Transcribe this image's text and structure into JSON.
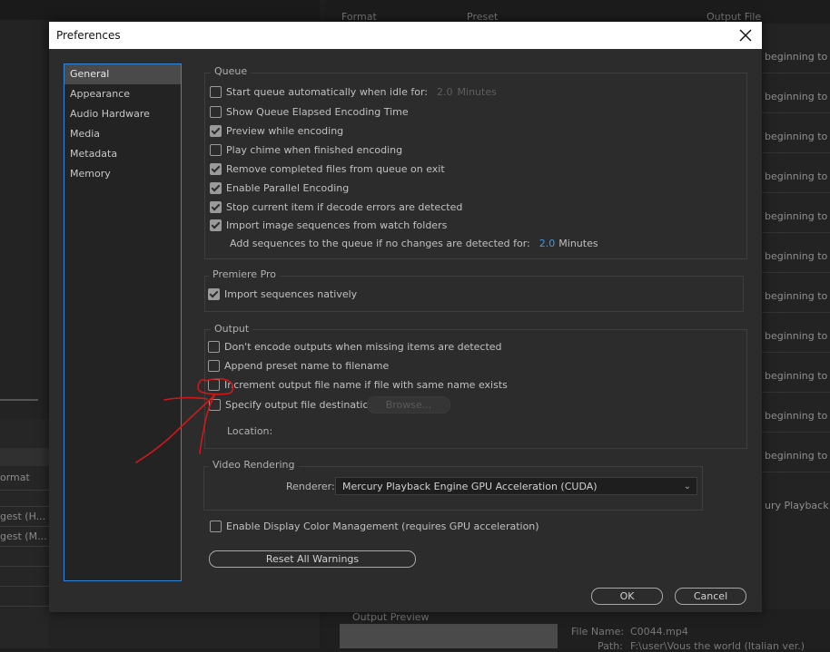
{
  "background": {
    "header": {
      "format": "Format",
      "preset": "Preset",
      "output_file": "Output File"
    },
    "row_text": "beginning to z",
    "row_text_last": "ury Playback E",
    "left_header": "ormat",
    "left_rows": [
      "gest (H...",
      "gest (M..."
    ],
    "bottom": {
      "file_name_label": "File Name:",
      "file_name_value": "C0044.mp4",
      "path_label": "Path:",
      "path_value": "F:\\user\\Vous the world (Italian ver.)",
      "output_preview": "Output Preview"
    }
  },
  "dialog": {
    "title": "Preferences",
    "sidebar": {
      "items": [
        {
          "label": "General",
          "active": true
        },
        {
          "label": "Appearance"
        },
        {
          "label": "Audio Hardware"
        },
        {
          "label": "Media"
        },
        {
          "label": "Metadata"
        },
        {
          "label": "Memory"
        }
      ]
    },
    "queue": {
      "label": "Queue",
      "start_queue": {
        "label": "Start queue automatically when idle for:",
        "value": "2.0",
        "unit": "Minutes",
        "checked": false
      },
      "show_elapsed": {
        "label": "Show Queue Elapsed Encoding Time",
        "checked": false
      },
      "preview": {
        "label": "Preview while encoding",
        "checked": true
      },
      "chime": {
        "label": "Play chime when finished encoding",
        "checked": false
      },
      "remove_completed": {
        "label": "Remove completed files from queue on exit",
        "checked": true
      },
      "parallel": {
        "label": "Enable Parallel Encoding",
        "checked": true
      },
      "stop_on_errors": {
        "label": "Stop current item if decode errors are detected",
        "checked": true
      },
      "import_sequences": {
        "label": "Import image sequences from watch folders",
        "checked": true
      },
      "add_sequences": {
        "label": "Add sequences to the queue if no changes are detected for:",
        "value": "2.0",
        "unit": "Minutes"
      }
    },
    "premiere": {
      "label": "Premiere Pro",
      "import_natively": {
        "label": "Import sequences natively",
        "checked": true
      }
    },
    "output": {
      "label": "Output",
      "dont_encode": {
        "label": "Don't encode outputs when missing items are detected",
        "checked": false
      },
      "append_preset": {
        "label": "Append preset name to filename",
        "checked": false
      },
      "increment": {
        "label": "Increment output file name if file with same name exists",
        "checked": false
      },
      "specify_dest": {
        "label": "Specify output file destination:",
        "checked": false
      },
      "browse": "Browse...",
      "location_label": "Location:"
    },
    "video_rendering": {
      "label": "Video Rendering",
      "renderer_label": "Renderer:",
      "renderer_value": "Mercury Playback Engine GPU Acceleration (CUDA)"
    },
    "color_mgmt": {
      "label": "Enable Display Color Management (requires GPU acceleration)",
      "checked": false
    },
    "reset_warnings": "Reset All Warnings",
    "ok": "OK",
    "cancel": "Cancel"
  },
  "colors": {
    "accent": "#2f86d8",
    "value_blue": "#3b9be8",
    "annotation": "#d01818"
  }
}
